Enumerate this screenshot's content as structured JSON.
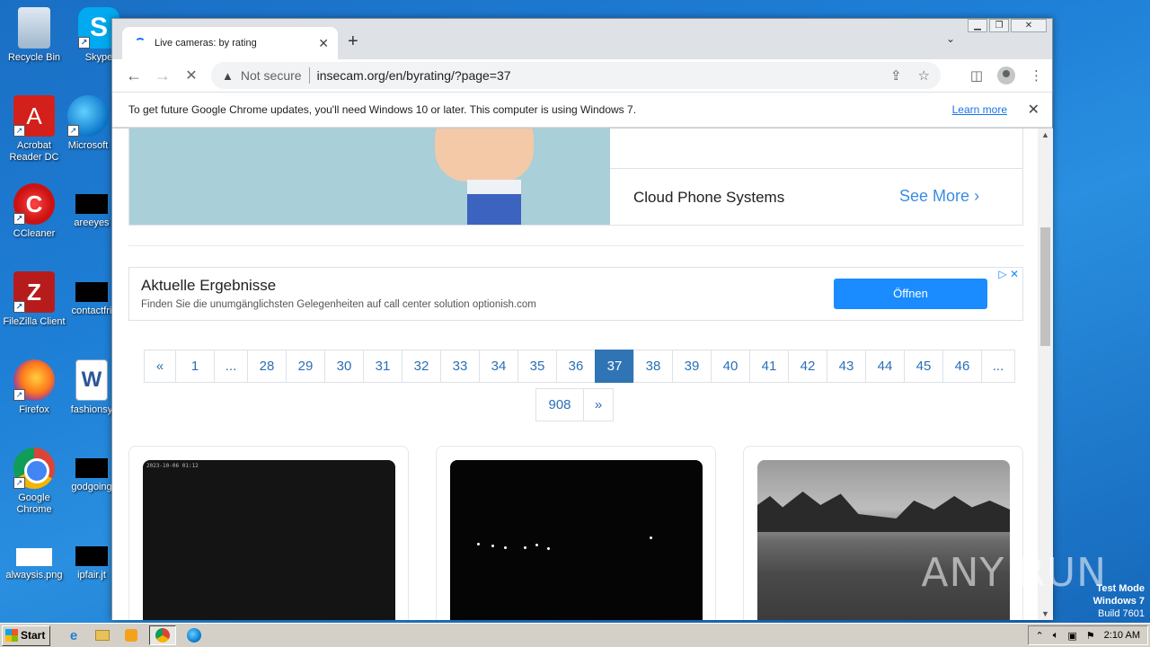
{
  "desktop": {
    "icons": [
      {
        "label": "Recycle Bin",
        "icon": "recycle-bin-icon"
      },
      {
        "label": "Skype",
        "icon": "skype-icon"
      },
      {
        "label": "Acrobat Reader DC",
        "icon": "acrobat-icon"
      },
      {
        "label": "Microsoft",
        "icon": "edge-icon"
      },
      {
        "label": "CCleaner",
        "icon": "ccleaner-icon"
      },
      {
        "label": "areeyes",
        "icon": "file-icon"
      },
      {
        "label": "FileZilla Client",
        "icon": "filezilla-icon"
      },
      {
        "label": "contactfri",
        "icon": "file-icon"
      },
      {
        "label": "Firefox",
        "icon": "firefox-icon"
      },
      {
        "label": "fashionsy",
        "icon": "word-doc-icon"
      },
      {
        "label": "Google Chrome",
        "icon": "chrome-icon"
      },
      {
        "label": "godgoing",
        "icon": "file-icon"
      },
      {
        "label": "alwaysis.png",
        "icon": "image-file-icon"
      },
      {
        "label": "ipfair.jt",
        "icon": "file-icon"
      }
    ]
  },
  "browser": {
    "tab": {
      "title": "Live cameras: by rating"
    },
    "address": {
      "security": "Not secure",
      "url": "insecam.org/en/byrating/?page=37"
    },
    "infobar": {
      "message": "To get future Google Chrome updates, you'll need Windows 10 or later. This computer is using Windows 7.",
      "link": "Learn more"
    }
  },
  "page": {
    "ad1": {
      "title": "Cloud Phone Systems",
      "cta": "See More"
    },
    "ad2": {
      "title": "Aktuelle Ergebnisse",
      "subtitle": "Finden Sie die unumgänglichsten Gelegenheiten auf call center solution optionish.com",
      "button": "Öffnen"
    },
    "pagination": {
      "row1": [
        "«",
        "1",
        "...",
        "28",
        "29",
        "30",
        "31",
        "32",
        "33",
        "34",
        "35",
        "36",
        "37",
        "38",
        "39",
        "40",
        "41",
        "42",
        "43",
        "44",
        "45",
        "46",
        "..."
      ],
      "row2": [
        "908",
        "»"
      ],
      "current": "37"
    },
    "cameras": [
      {
        "timestamp": "2023-10-06 01:12"
      },
      {},
      {}
    ]
  },
  "watermark": "ANY RUN",
  "os_mode": {
    "line1": "Test Mode",
    "line2": "Windows 7",
    "line3": "Build 7601"
  },
  "taskbar": {
    "start": "Start",
    "clock": "2:10 AM"
  },
  "colors": {
    "accent": "#1a73e8",
    "pager_active": "#2f74b5",
    "ad_button": "#1a8cff",
    "desktop": "#1e7fd6"
  }
}
